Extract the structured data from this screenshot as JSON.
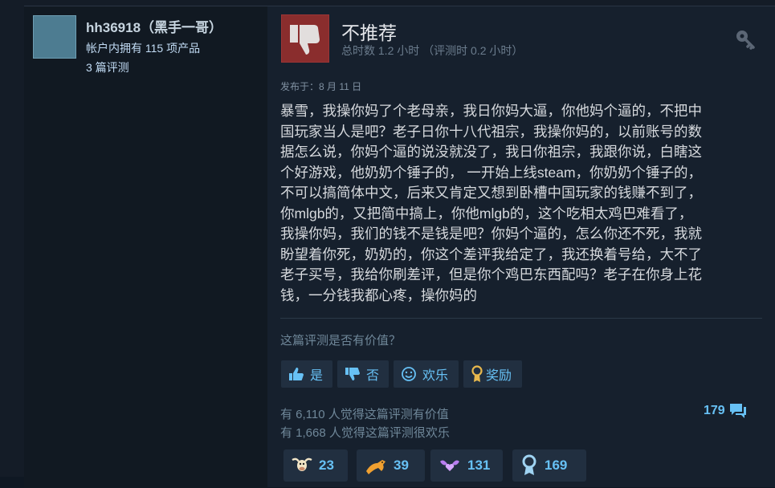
{
  "user": {
    "name": "hh36918（黑手一哥）",
    "products_owned": "帐户内拥有 115 项产品",
    "review_count": "3 篇评测"
  },
  "review": {
    "verdict": "不推荐",
    "hours": "总时数 1.2 小时 （评测时 0.2 小时）",
    "posted": "发布于：8 月 11 日",
    "body_lines": [
      "暴雪，我操你妈了个老母亲，我日你妈大逼，你他妈个逼的，不把中",
      "国玩家当人是吧？老子日你十八代祖宗，我操你妈的，以前账号的数",
      "据怎么说，你妈个逼的说没就没了，我日你祖宗，我跟你说，白瞎这",
      "个好游戏，他奶奶个锤子的， 一开始上线steam，你奶奶个锤子的，",
      "不可以搞简体中文，后来又肯定又想到卧槽中国玩家的钱赚不到了，",
      "你mlgb的，又把简中搞上，你他mlgb的，这个吃相太鸡巴难看了，",
      "我操你妈，我们的钱不是钱是吧？你妈个逼的，怎么你还不死，我就",
      "盼望着你死，奶奶的，你这个差评我给定了，我还换着号给，大不了",
      "老子买号，我给你刷差评，但是你个鸡巴东西配吗？老子在你身上花",
      "钱，一分钱我都心疼，操你妈的"
    ]
  },
  "feedback": {
    "question": "这篇评测是否有价值？",
    "yes_label": "是",
    "no_label": "否",
    "funny_label": "欢乐",
    "award_label": "奖励"
  },
  "stats": {
    "helpful": "有 6,110 人觉得这篇评测有价值",
    "funny": "有 1,668 人觉得这篇评测很欢乐",
    "comments": "179"
  },
  "awards": [
    {
      "icon": "cow-icon",
      "count": "23"
    },
    {
      "icon": "horse-icon",
      "count": "39"
    },
    {
      "icon": "winged-heart-icon",
      "count": "131"
    },
    {
      "icon": "medal-icon",
      "count": "169"
    }
  ],
  "colors": {
    "accent": "#67c1f5",
    "thumb_down_bg": "#8a2d2d",
    "background": "#16202d"
  }
}
